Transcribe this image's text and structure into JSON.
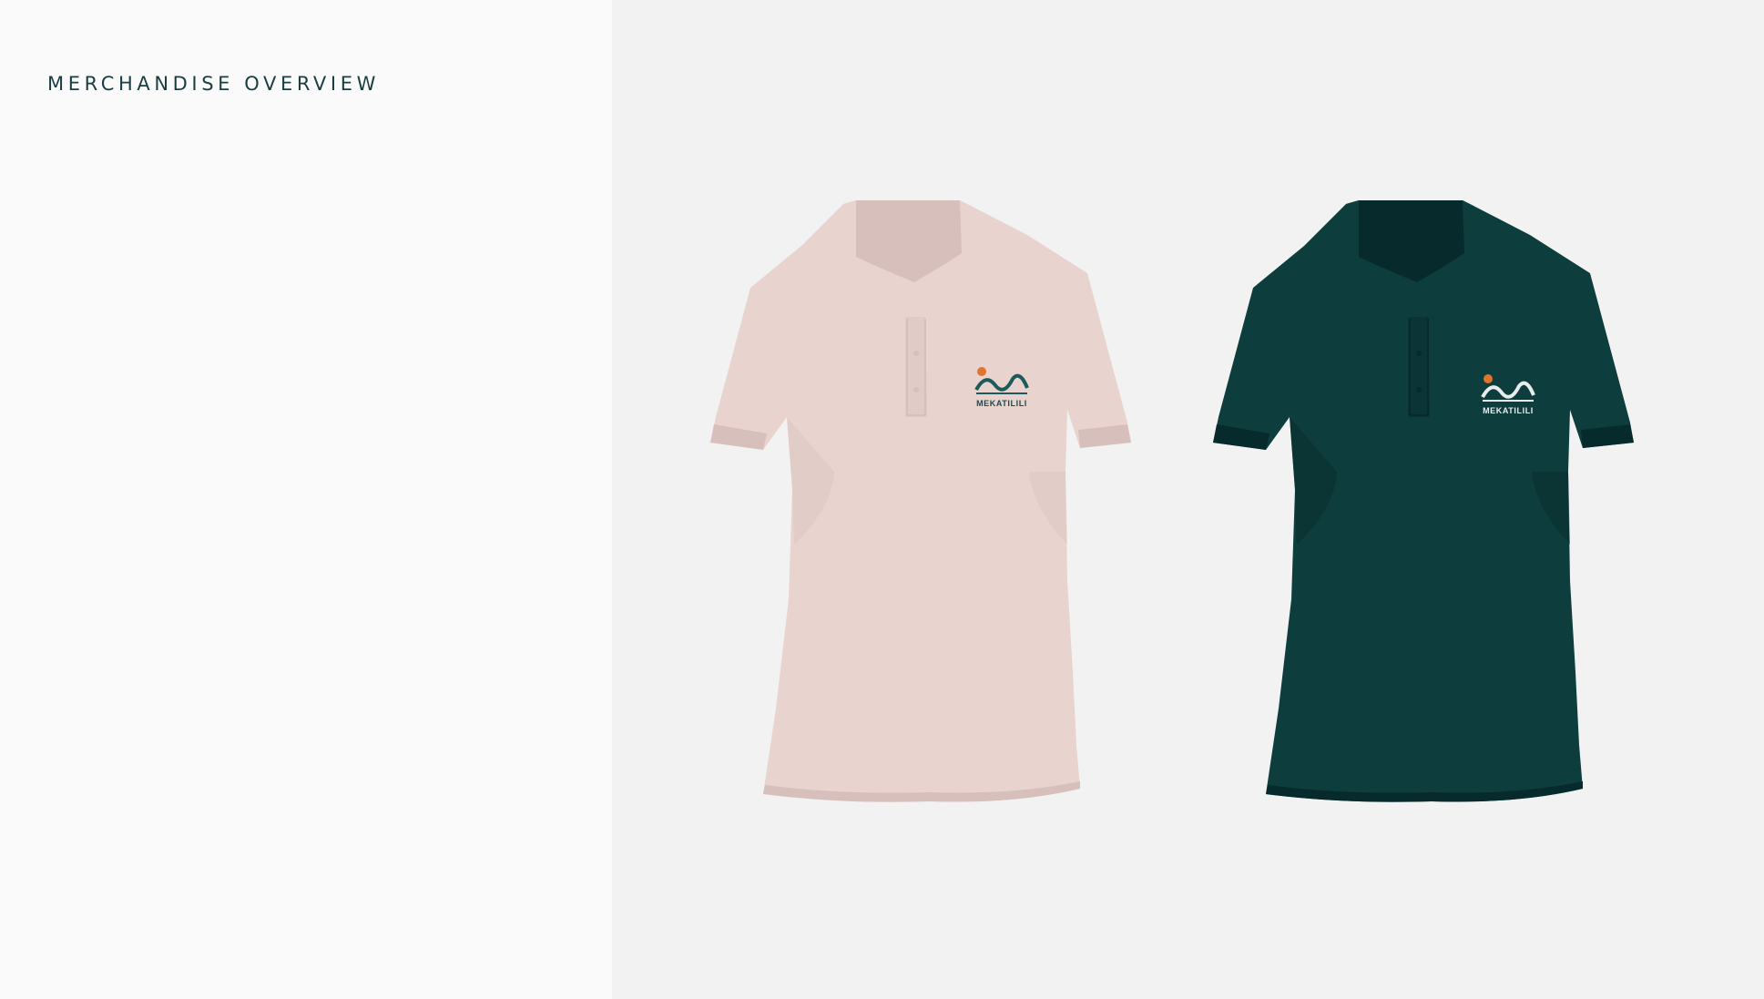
{
  "page": {
    "title": "MERCHANDISE OVERVIEW"
  },
  "products": [
    {
      "type": "polo-shirt",
      "color_name": "blush pink",
      "fabric_color": "#e8d3cf",
      "shade_color": "#d7c0bb",
      "logo_text": "MEKATILILI",
      "logo_text_color": "#1d4a4c",
      "logo_mark_color": "#1d5a5a",
      "logo_dot_color": "#e0742c"
    },
    {
      "type": "polo-shirt",
      "color_name": "deep teal",
      "fabric_color": "#0e3d3d",
      "shade_color": "#072b2c",
      "logo_text": "MEKATILILI",
      "logo_text_color": "#e8ecec",
      "logo_mark_color": "#e8ecec",
      "logo_dot_color": "#e0742c"
    }
  ]
}
